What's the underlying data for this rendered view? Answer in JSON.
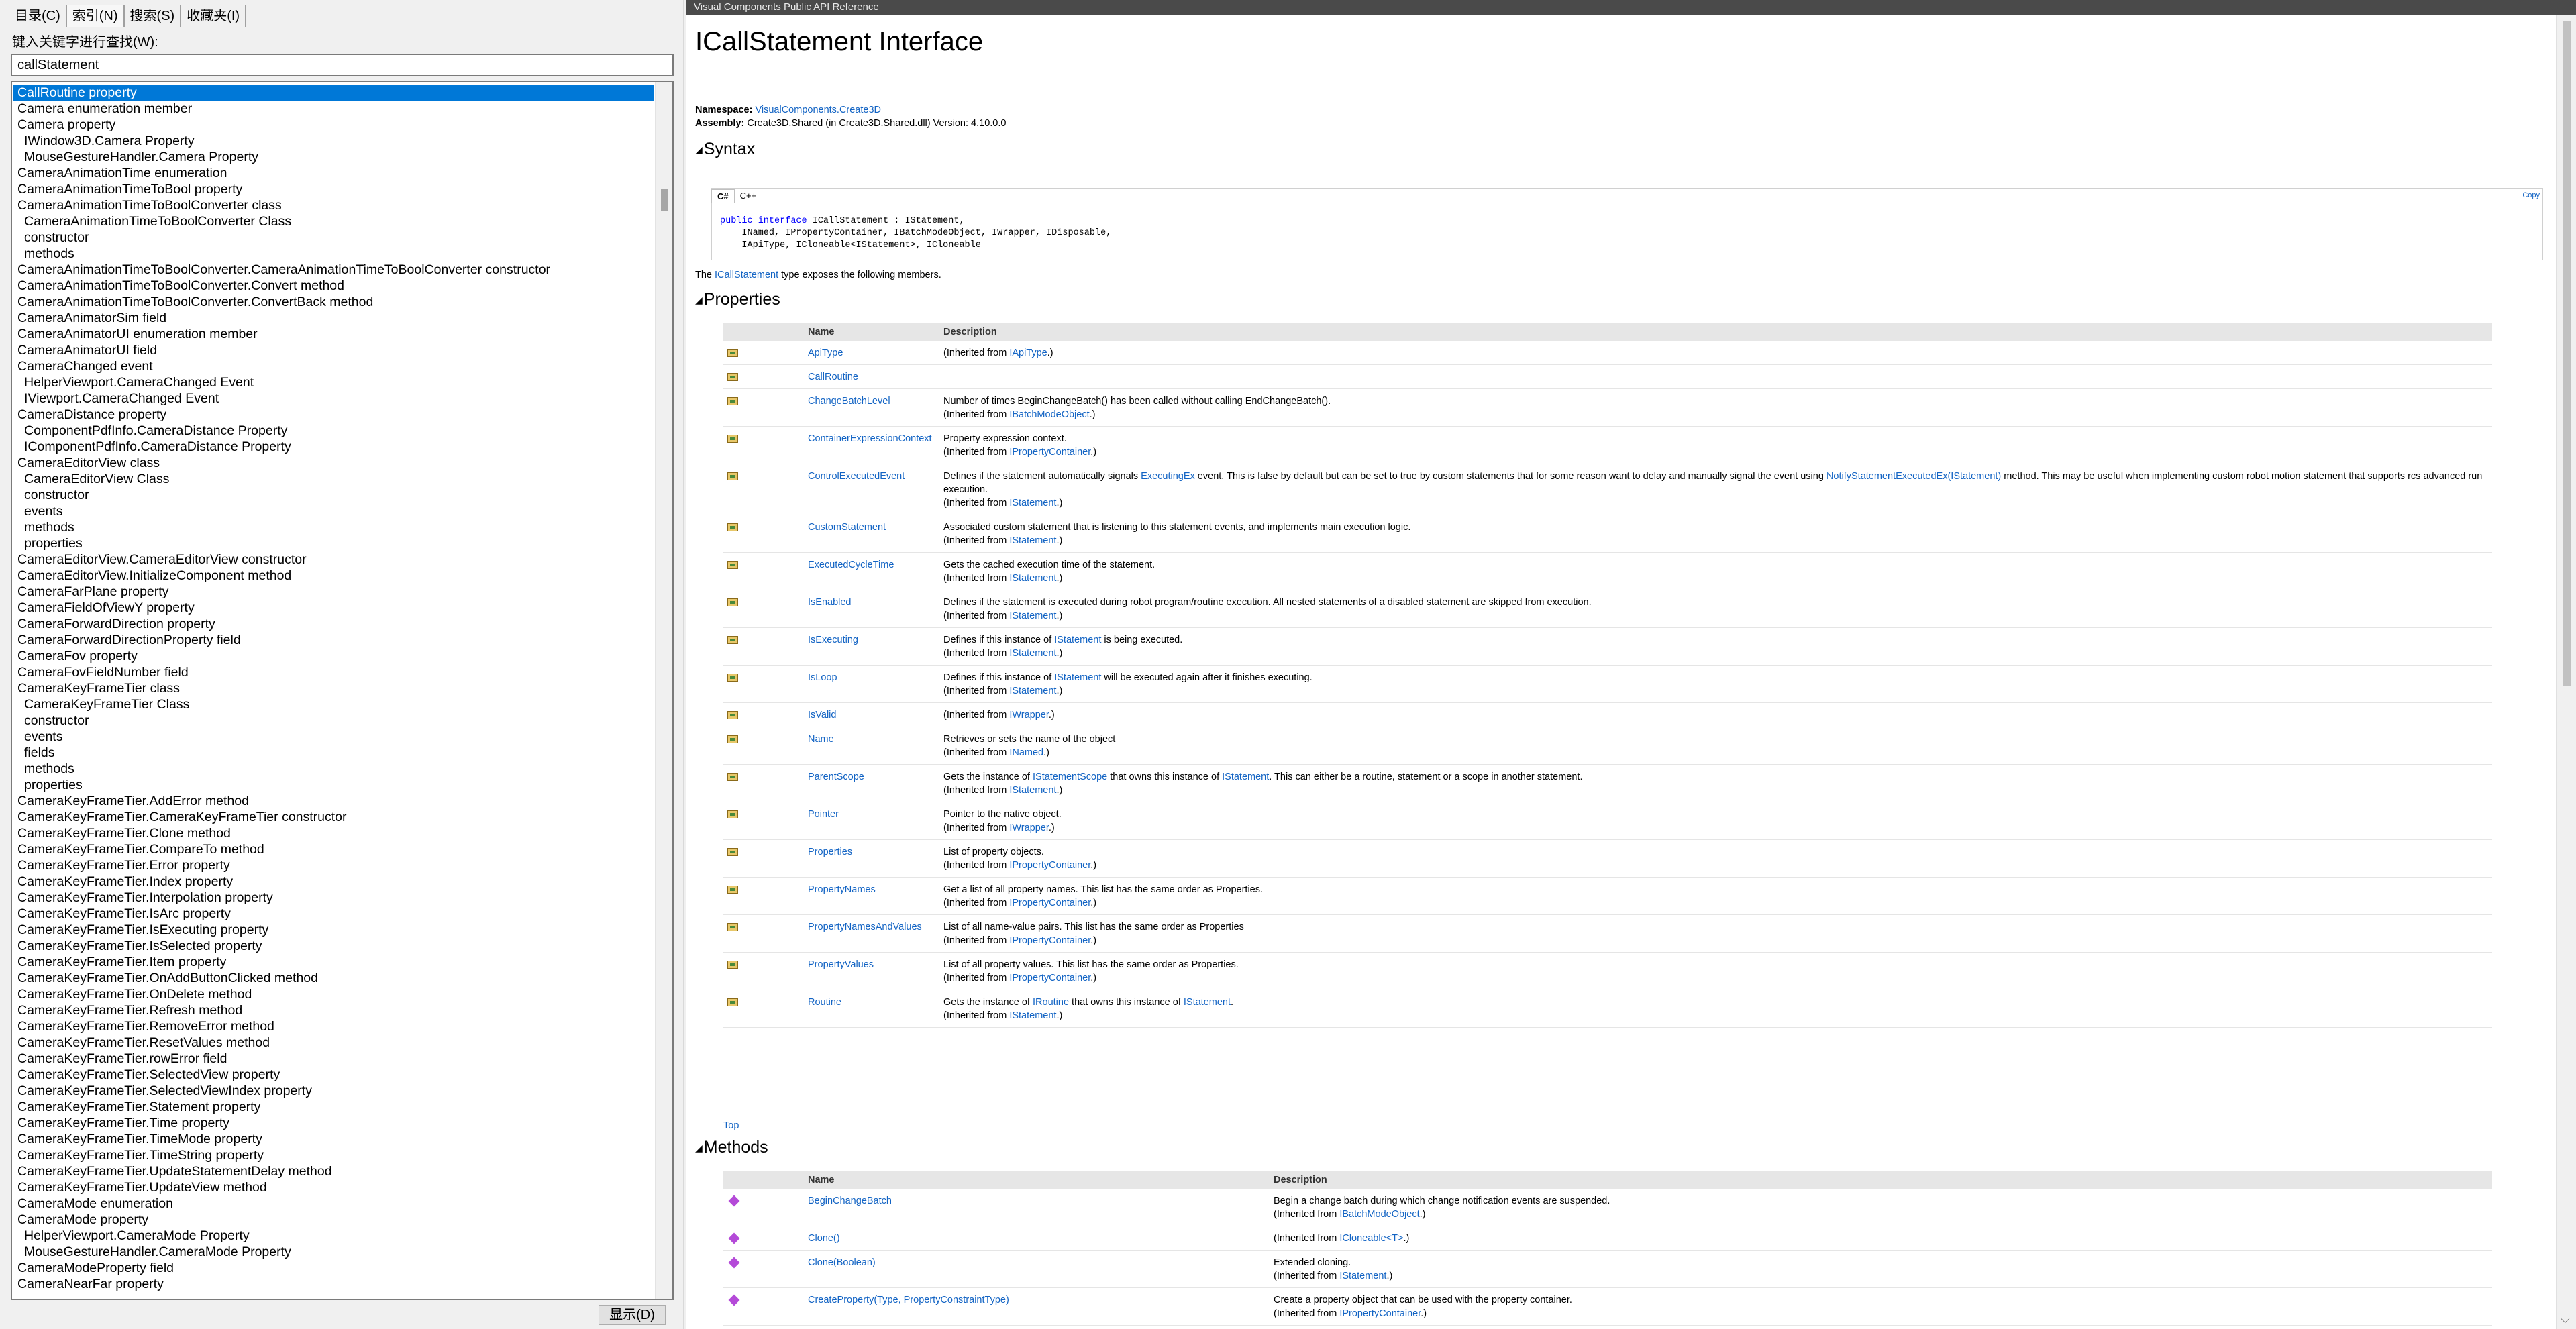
{
  "left": {
    "tabs": [
      "目录(C)",
      "索引(N)",
      "搜索(S)",
      "收藏夹(I)"
    ],
    "keyword_label": "键入关键字进行查找(W):",
    "search_value": "callStatement",
    "display_button": "显示(D)",
    "items": [
      {
        "text": "CallRoutine property",
        "indent": false,
        "selected": true
      },
      {
        "text": "Camera enumeration member",
        "indent": false
      },
      {
        "text": "Camera property",
        "indent": false
      },
      {
        "text": "IWindow3D.Camera Property",
        "indent": true
      },
      {
        "text": "MouseGestureHandler.Camera Property",
        "indent": true
      },
      {
        "text": "CameraAnimationTime enumeration",
        "indent": false
      },
      {
        "text": "CameraAnimationTimeToBool property",
        "indent": false
      },
      {
        "text": "CameraAnimationTimeToBoolConverter class",
        "indent": false
      },
      {
        "text": "CameraAnimationTimeToBoolConverter Class",
        "indent": true
      },
      {
        "text": "constructor",
        "indent": true
      },
      {
        "text": "methods",
        "indent": true
      },
      {
        "text": "CameraAnimationTimeToBoolConverter.CameraAnimationTimeToBoolConverter constructor",
        "indent": false
      },
      {
        "text": "CameraAnimationTimeToBoolConverter.Convert method",
        "indent": false
      },
      {
        "text": "CameraAnimationTimeToBoolConverter.ConvertBack method",
        "indent": false
      },
      {
        "text": "CameraAnimatorSim field",
        "indent": false
      },
      {
        "text": "CameraAnimatorUI enumeration member",
        "indent": false
      },
      {
        "text": "CameraAnimatorUI field",
        "indent": false
      },
      {
        "text": "CameraChanged event",
        "indent": false
      },
      {
        "text": "HelperViewport.CameraChanged Event",
        "indent": true
      },
      {
        "text": "IViewport.CameraChanged Event",
        "indent": true
      },
      {
        "text": "CameraDistance property",
        "indent": false
      },
      {
        "text": "ComponentPdfInfo.CameraDistance Property",
        "indent": true
      },
      {
        "text": "IComponentPdfInfo.CameraDistance Property",
        "indent": true
      },
      {
        "text": "CameraEditorView class",
        "indent": false
      },
      {
        "text": "CameraEditorView Class",
        "indent": true
      },
      {
        "text": "constructor",
        "indent": true
      },
      {
        "text": "events",
        "indent": true
      },
      {
        "text": "methods",
        "indent": true
      },
      {
        "text": "properties",
        "indent": true
      },
      {
        "text": "CameraEditorView.CameraEditorView constructor",
        "indent": false
      },
      {
        "text": "CameraEditorView.InitializeComponent method",
        "indent": false
      },
      {
        "text": "CameraFarPlane property",
        "indent": false
      },
      {
        "text": "CameraFieldOfViewY property",
        "indent": false
      },
      {
        "text": "CameraForwardDirection property",
        "indent": false
      },
      {
        "text": "CameraForwardDirectionProperty field",
        "indent": false
      },
      {
        "text": "CameraFov property",
        "indent": false
      },
      {
        "text": "CameraFovFieldNumber field",
        "indent": false
      },
      {
        "text": "CameraKeyFrameTier class",
        "indent": false
      },
      {
        "text": "CameraKeyFrameTier Class",
        "indent": true
      },
      {
        "text": "constructor",
        "indent": true
      },
      {
        "text": "events",
        "indent": true
      },
      {
        "text": "fields",
        "indent": true
      },
      {
        "text": "methods",
        "indent": true
      },
      {
        "text": "properties",
        "indent": true
      },
      {
        "text": "CameraKeyFrameTier.AddError method",
        "indent": false
      },
      {
        "text": "CameraKeyFrameTier.CameraKeyFrameTier constructor",
        "indent": false
      },
      {
        "text": "CameraKeyFrameTier.Clone method",
        "indent": false
      },
      {
        "text": "CameraKeyFrameTier.CompareTo method",
        "indent": false
      },
      {
        "text": "CameraKeyFrameTier.Error property",
        "indent": false
      },
      {
        "text": "CameraKeyFrameTier.Index property",
        "indent": false
      },
      {
        "text": "CameraKeyFrameTier.Interpolation property",
        "indent": false
      },
      {
        "text": "CameraKeyFrameTier.IsArc property",
        "indent": false
      },
      {
        "text": "CameraKeyFrameTier.IsExecuting property",
        "indent": false
      },
      {
        "text": "CameraKeyFrameTier.IsSelected property",
        "indent": false
      },
      {
        "text": "CameraKeyFrameTier.Item property",
        "indent": false
      },
      {
        "text": "CameraKeyFrameTier.OnAddButtonClicked method",
        "indent": false
      },
      {
        "text": "CameraKeyFrameTier.OnDelete method",
        "indent": false
      },
      {
        "text": "CameraKeyFrameTier.Refresh method",
        "indent": false
      },
      {
        "text": "CameraKeyFrameTier.RemoveError method",
        "indent": false
      },
      {
        "text": "CameraKeyFrameTier.ResetValues method",
        "indent": false
      },
      {
        "text": "CameraKeyFrameTier.rowError field",
        "indent": false
      },
      {
        "text": "CameraKeyFrameTier.SelectedView property",
        "indent": false
      },
      {
        "text": "CameraKeyFrameTier.SelectedViewIndex property",
        "indent": false
      },
      {
        "text": "CameraKeyFrameTier.Statement property",
        "indent": false
      },
      {
        "text": "CameraKeyFrameTier.Time property",
        "indent": false
      },
      {
        "text": "CameraKeyFrameTier.TimeMode property",
        "indent": false
      },
      {
        "text": "CameraKeyFrameTier.TimeString property",
        "indent": false
      },
      {
        "text": "CameraKeyFrameTier.UpdateStatementDelay method",
        "indent": false
      },
      {
        "text": "CameraKeyFrameTier.UpdateView method",
        "indent": false
      },
      {
        "text": "CameraMode enumeration",
        "indent": false
      },
      {
        "text": "CameraMode property",
        "indent": false
      },
      {
        "text": "HelperViewport.CameraMode Property",
        "indent": true
      },
      {
        "text": "MouseGestureHandler.CameraMode Property",
        "indent": true
      },
      {
        "text": "CameraModeProperty field",
        "indent": false
      },
      {
        "text": "CameraNearFar property",
        "indent": false
      }
    ]
  },
  "right": {
    "window_title": "Visual Components Public API Reference",
    "page_title": "ICallStatement Interface",
    "namespace_label": "Namespace:",
    "namespace_value": "VisualComponents.Create3D",
    "assembly_label": "Assembly:",
    "assembly_value": "Create3D.Shared (in Create3D.Shared.dll) Version: 4.10.0.0",
    "syntax_heading": "Syntax",
    "code_tabs": [
      "C#",
      "C++"
    ],
    "copy_label": "Copy",
    "code_line1_kw": "public interface",
    "code_line1_rest": " ICallStatement : IStatement,",
    "code_line2": "    INamed, IPropertyContainer, IBatchModeObject, IWrapper, IDisposable,",
    "code_line3": "    IApiType, ICloneable<IStatement>, ICloneable",
    "exposes_pre": "The ",
    "exposes_link": "ICallStatement",
    "exposes_post": " type exposes the following members.",
    "properties_heading": "Properties",
    "methods_heading": "Methods",
    "col_name": "Name",
    "col_description": "Description",
    "top_link": "Top",
    "properties": [
      {
        "name": "ApiType",
        "desc": "",
        "from_pre": "(Inherited from ",
        "from": "IApiType",
        "from_post": ".)"
      },
      {
        "name": "CallRoutine",
        "desc": "",
        "from_pre": "",
        "from": "",
        "from_post": ""
      },
      {
        "name": "ChangeBatchLevel",
        "desc": "Number of times BeginChangeBatch() has been called without calling EndChangeBatch().",
        "from_pre": "(Inherited from ",
        "from": "IBatchModeObject",
        "from_post": ".)"
      },
      {
        "name": "ContainerExpressionContext",
        "desc": "Property expression context.",
        "from_pre": "(Inherited from ",
        "from": "IPropertyContainer",
        "from_post": ".)"
      },
      {
        "name": "ControlExecutedEvent",
        "desc_pre": "Defines if the statement automatically signals ",
        "desc_link": "ExecutingEx",
        "desc_mid": " event. This is false by default but can be set to true by custom statements that for some reason want to delay and manually signal the event using ",
        "desc_link2": "NotifyStatementExecutedEx(IStatement)",
        "desc_post": " method. This may be useful when implementing custom robot motion statement that supports rcs advanced run execution.",
        "from_pre": "(Inherited from ",
        "from": "IStatement",
        "from_post": ".)"
      },
      {
        "name": "CustomStatement",
        "desc": "Associated custom statement that is listening to this statement events, and implements main execution logic.",
        "from_pre": "(Inherited from ",
        "from": "IStatement",
        "from_post": ".)"
      },
      {
        "name": "ExecutedCycleTime",
        "desc": "Gets the cached execution time of the statement.",
        "from_pre": "(Inherited from ",
        "from": "IStatement",
        "from_post": ".)"
      },
      {
        "name": "IsEnabled",
        "desc": "Defines if the statement is executed during robot program/routine execution. All nested statements of a disabled statement are skipped from execution.",
        "from_pre": "(Inherited from ",
        "from": "IStatement",
        "from_post": ".)"
      },
      {
        "name": "IsExecuting",
        "desc_pre": "Defines if this instance of ",
        "desc_link": "IStatement",
        "desc_post": " is being executed.",
        "from_pre": "(Inherited from ",
        "from": "IStatement",
        "from_post": ".)"
      },
      {
        "name": "IsLoop",
        "desc_pre": "Defines if this instance of ",
        "desc_link": "IStatement",
        "desc_post": " will be executed again after it finishes executing.",
        "from_pre": "(Inherited from ",
        "from": "IStatement",
        "from_post": ".)"
      },
      {
        "name": "IsValid",
        "desc": "",
        "from_pre": "(Inherited from ",
        "from": "IWrapper",
        "from_post": ".)"
      },
      {
        "name": "Name",
        "desc": "Retrieves or sets the name of the object",
        "from_pre": "(Inherited from ",
        "from": "INamed",
        "from_post": ".)"
      },
      {
        "name": "ParentScope",
        "desc_pre": "Gets the instance of ",
        "desc_link": "IStatementScope",
        "desc_mid": " that owns this instance of ",
        "desc_link2": "IStatement",
        "desc_post": ". This can either be a routine, statement or a scope in another statement.",
        "from_pre": "(Inherited from ",
        "from": "IStatement",
        "from_post": ".)"
      },
      {
        "name": "Pointer",
        "desc": "Pointer to the native object.",
        "from_pre": "(Inherited from ",
        "from": "IWrapper",
        "from_post": ".)"
      },
      {
        "name": "Properties",
        "desc": "List of property objects.",
        "from_pre": "(Inherited from ",
        "from": "IPropertyContainer",
        "from_post": ".)"
      },
      {
        "name": "PropertyNames",
        "desc": "Get a list of all property names. This list has the same order as Properties.",
        "from_pre": "(Inherited from ",
        "from": "IPropertyContainer",
        "from_post": ".)"
      },
      {
        "name": "PropertyNamesAndValues",
        "desc": "List of all name-value pairs. This list has the same order as Properties",
        "from_pre": "(Inherited from ",
        "from": "IPropertyContainer",
        "from_post": ".)"
      },
      {
        "name": "PropertyValues",
        "desc": "List of all property values. This list has the same order as Properties.",
        "from_pre": "(Inherited from ",
        "from": "IPropertyContainer",
        "from_post": ".)"
      },
      {
        "name": "Routine",
        "desc_pre": "Gets the instance of ",
        "desc_link": "IRoutine",
        "desc_mid": " that owns this instance of ",
        "desc_link2": "IStatement",
        "desc_post": ".",
        "from_pre": "(Inherited from ",
        "from": "IStatement",
        "from_post": ".)"
      }
    ],
    "methods": [
      {
        "name": "BeginChangeBatch",
        "desc": "Begin a change batch during which change notification events are suspended.",
        "from_pre": "(Inherited from ",
        "from": "IBatchModeObject",
        "from_post": ".)"
      },
      {
        "name": "Clone()",
        "desc": "",
        "from_pre": "(Inherited from ",
        "from": "ICloneable<T>",
        "from_post": ".)"
      },
      {
        "name": "Clone(Boolean)",
        "desc": "Extended cloning.",
        "from_pre": "(Inherited from ",
        "from": "IStatement",
        "from_post": ".)"
      },
      {
        "name": "CreateProperty(Type, PropertyConstraintType)",
        "desc": "Create a property object that can be used with the property container.",
        "from_pre": "(Inherited from ",
        "from": "IPropertyContainer",
        "from_post": ".)"
      }
    ]
  }
}
